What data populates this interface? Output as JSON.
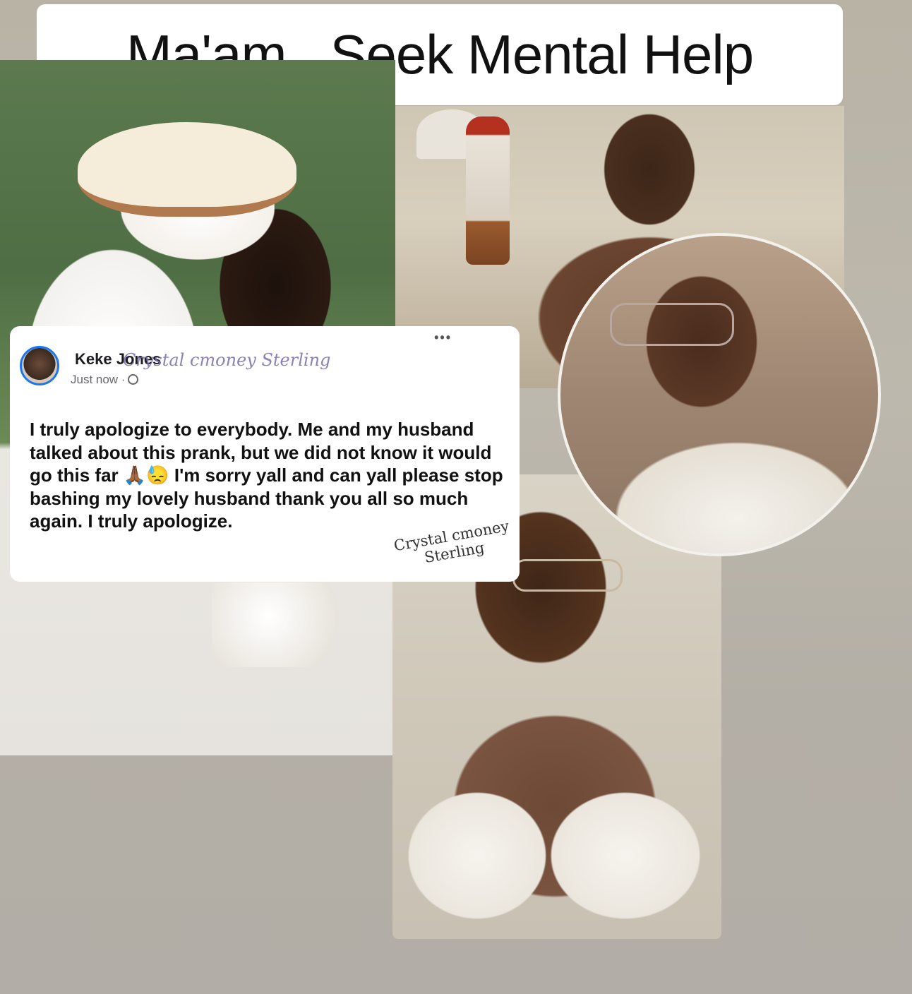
{
  "header": {
    "title": "Ma'am...Seek Mental Help"
  },
  "post": {
    "author": "Keke Jones",
    "timestamp": "Just now ·",
    "more_icon": "•••",
    "body": "I truly apologize to everybody. Me and my husband talked about this prank, but we did not know it would go this far 🙏🏾😓 I'm sorry yall and can yall please stop bashing my lovely husband thank you all so much again. I truly apologize.",
    "watermark_top": "Crystal cmoney Sterling",
    "watermark_bottom_line1": "Crystal cmoney",
    "watermark_bottom_line2": "Sterling"
  }
}
